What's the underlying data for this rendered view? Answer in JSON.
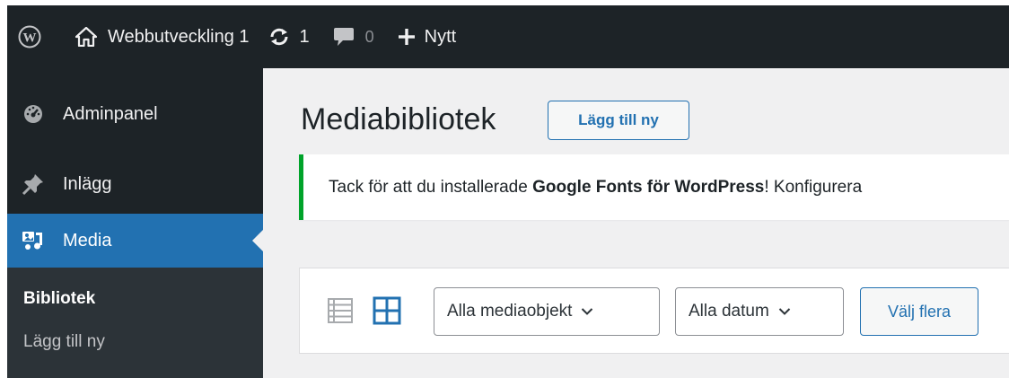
{
  "adminbar": {
    "wp_logo_icon": "wordpress-logo-icon",
    "site_name": "Webbutveckling 1",
    "updates_count": "1",
    "comments_count": "0",
    "new_label": "Nytt"
  },
  "sidebar": {
    "items": [
      {
        "label": "Adminpanel",
        "icon": "dashboard-icon"
      },
      {
        "label": "Inlägg",
        "icon": "pin-icon"
      },
      {
        "label": "Media",
        "icon": "media-icon"
      }
    ],
    "submenu": [
      {
        "label": "Bibliotek"
      },
      {
        "label": "Lägg till ny"
      }
    ]
  },
  "main": {
    "title": "Mediabibliotek",
    "add_new_label": "Lägg till ny",
    "notice": {
      "prefix": "Tack för att du installerade ",
      "plugin": "Google Fonts för WordPress",
      "suffix": "! Konfigurera"
    },
    "toolbar": {
      "type_filter": "Alla mediaobjekt",
      "date_filter": "Alla datum",
      "bulk_select_label": "Välj flera"
    }
  },
  "colors": {
    "adminbar_bg": "#1d2327",
    "accent": "#2271b1",
    "notice_success": "#00a32a",
    "page_bg": "#f0f0f1"
  }
}
